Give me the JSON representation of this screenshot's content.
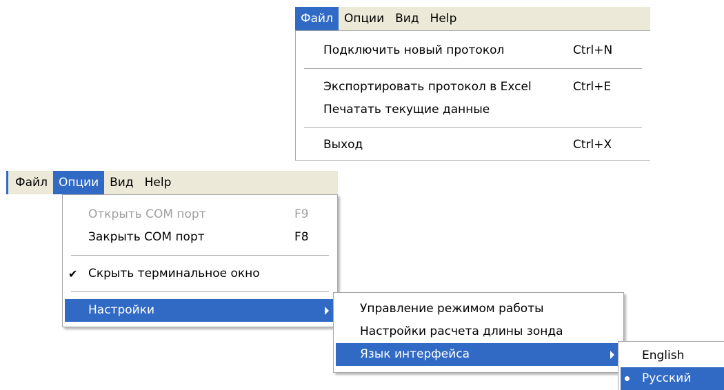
{
  "top_menubar": {
    "items": [
      {
        "label": "Файл"
      },
      {
        "label": "Опции"
      },
      {
        "label": "Вид"
      },
      {
        "label": "Help"
      }
    ]
  },
  "file_menu": {
    "items": [
      {
        "label": "Подключить новый протокол",
        "shortcut": "Ctrl+N"
      },
      {
        "label": "Экспортировать протокол в Excel",
        "shortcut": "Ctrl+E"
      },
      {
        "label": "Печатать текущие данные",
        "shortcut": ""
      },
      {
        "label": "Выход",
        "shortcut": "Ctrl+X"
      }
    ]
  },
  "bottom_menubar": {
    "items": [
      {
        "label": "Файл"
      },
      {
        "label": "Опции"
      },
      {
        "label": "Вид"
      },
      {
        "label": "Help"
      }
    ]
  },
  "options_menu": {
    "items": [
      {
        "label": "Открыть COM порт",
        "shortcut": "F9",
        "disabled": true
      },
      {
        "label": "Закрыть COM порт",
        "shortcut": "F8"
      },
      {
        "label": "Скрыть терминальное окно",
        "checked": true
      },
      {
        "label": "Настройки",
        "has_submenu": true
      }
    ],
    "check_glyph": "✔"
  },
  "settings_submenu": {
    "items": [
      {
        "label": "Управление режимом работы"
      },
      {
        "label": "Настройки расчета длины зонда"
      },
      {
        "label": "Язык интерфейса",
        "has_submenu": true
      }
    ]
  },
  "language_submenu": {
    "items": [
      {
        "label": "English"
      },
      {
        "label": "Русский",
        "selected": true
      }
    ]
  },
  "colors": {
    "highlight": "#316ac5",
    "menubar_bg": "#ece9d8",
    "disabled_text": "#a0a0a0"
  }
}
